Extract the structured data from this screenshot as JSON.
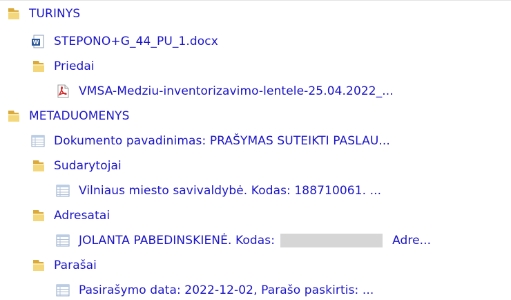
{
  "tree": {
    "turinys": {
      "label": "TURINYS",
      "icon": "folder-icon"
    },
    "docx": {
      "label": "STEPONO+G_44_PU_1.docx",
      "icon": "word-document-icon"
    },
    "priedai": {
      "label": "Priedai",
      "icon": "folder-icon"
    },
    "pdf": {
      "label": "VMSA-Medziu-inventorizavimo-lentele-25.04.2022_...",
      "icon": "pdf-file-icon"
    },
    "metaduomenys": {
      "label": "METADUOMENYS",
      "icon": "folder-icon"
    },
    "dokumento_pavadinimas": {
      "label": "Dokumento pavadinimas: PRAŠYMAS SUTEIKTI PASLAU...",
      "icon": "table-icon"
    },
    "sudarytojai": {
      "label": "Sudarytojai",
      "icon": "folder-icon"
    },
    "sudarytojas_1": {
      "label": "Vilniaus miesto savivaldybė. Kodas: 188710061. ...",
      "icon": "table-icon"
    },
    "adresatai": {
      "label": "Adresatai",
      "icon": "folder-icon"
    },
    "adresatas_1": {
      "label_before": "JOLANTA PABEDINSKIENĖ. Kodas:",
      "label_after": "Adre...",
      "icon": "table-icon"
    },
    "parasai": {
      "label": "Parašai",
      "icon": "folder-icon"
    },
    "parasas_1": {
      "label": "Pasirašymo data: 2022-12-02, Parašo paskirtis: ...",
      "icon": "table-icon"
    }
  },
  "colors": {
    "link": "#1a14c8",
    "folder": "#e8c65a",
    "redaction": "#d6d6d6"
  }
}
